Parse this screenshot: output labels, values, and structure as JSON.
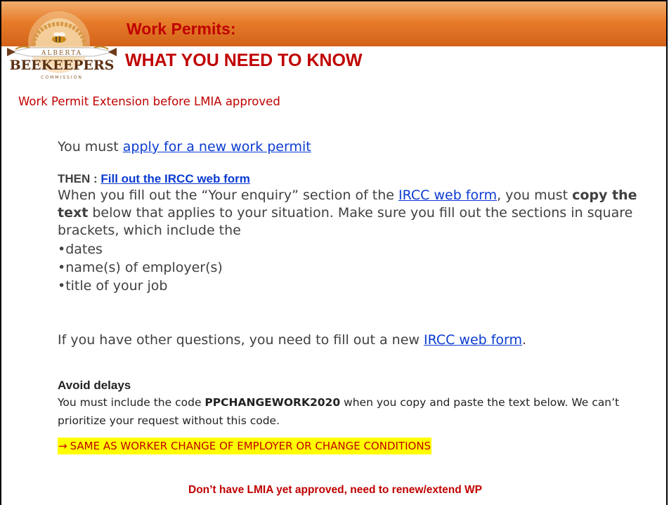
{
  "header": {
    "title_line1": "Work Permits:",
    "title_line2": "WHAT YOU NEED TO KNOW",
    "logo": {
      "icon": "bee-icon",
      "top_text": "ALBERTA",
      "main_text": "BEEKEEPERS",
      "bottom_text": "COMMISSION"
    }
  },
  "subtitle": "Work Permit Extension before LMIA approved",
  "apply": {
    "prefix": "You must ",
    "link": "apply for a new work permit"
  },
  "then": {
    "prefix": "THEN : ",
    "link": "Fill out the IRCC web form"
  },
  "enquiry": {
    "part1": "When you fill out the “Your enquiry” section of the ",
    "link": "IRCC web form",
    "part2": ", you must ",
    "bold": "copy the text",
    "part3": " below that applies to your situation. Make sure you fill out the sections in square brackets, which include the"
  },
  "bullets": [
    "•dates",
    "•name(s) of employer(s)",
    "•title of your job"
  ],
  "other_questions": {
    "text": "If you have other questions, you need to fill out a new ",
    "link": "IRCC web form",
    "suffix": "."
  },
  "avoid_delays": {
    "heading": "Avoid delays",
    "part1": "You must include the code ",
    "code": "PPCHANGEWORK2020",
    "part2": " when you copy and paste the text below. We can’t prioritize your request without this code."
  },
  "highlight": {
    "arrow": "→",
    "text": "SAME AS WORKER CHANGE OF EMPLOYER OR CHANGE CONDITIONS"
  },
  "bottom_note": "Don’t have LMIA yet approved, need to renew/extend WP",
  "colors": {
    "accent_red": "#c00000",
    "link_blue": "#0b3bd1",
    "header_orange": "#e77c2a",
    "highlight_yellow": "#ffff00"
  }
}
